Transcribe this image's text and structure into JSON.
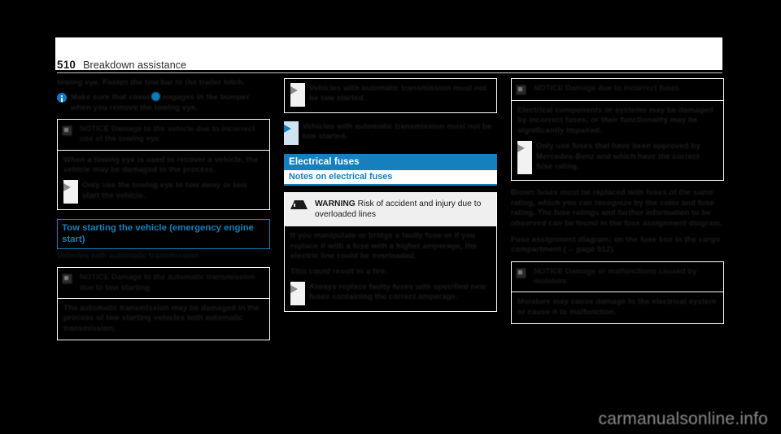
{
  "document": {
    "page_number": "510",
    "chapter": "Breakdown assistance",
    "watermark": "carmanualsonline.info"
  },
  "left_column": {
    "continued_paragraph": "towing eye. Fasten the tow bar to the trailer hitch.",
    "info_note_pre": "Make sure that cover",
    "info_note_post": "engages in the bumper when you remove the towing eye.",
    "notice_towing_eye": {
      "label": "NOTICE",
      "title": "Damage to the vehicle due to incorrect use of the towing eye",
      "body": "When a towing eye is used to recover a vehicle, the vehicle may be damaged in the process.",
      "bullet": "Only use the towing eye to tow away or tow start the vehicle."
    },
    "heading_tow_start": "Tow starting the vehicle (emergency engine start)",
    "subheading_automatic": "Vehicles with automatic transmission",
    "notice_tow_start": {
      "label": "NOTICE",
      "title": "Damage to the automatic transmission due to tow starting",
      "body": "The automatic transmission may be damaged in the process of tow starting vehicles with automatic transmission."
    }
  },
  "middle_column": {
    "notice_bullet": "Vehicles with automatic transmission must not be tow started.",
    "blue_bullet": "Vehicles with automatic transmission must not be tow started.",
    "heading_electrical_fuses": "Electrical fuses",
    "subheading_notes": "Notes on electrical fuses",
    "warning": {
      "label": "WARNING",
      "title": "Risk of accident and injury due to overloaded lines",
      "body_1": "If you manipulate or bridge a faulty fuse or if you replace it with a fuse with a higher amperage, the electric line could be overloaded.",
      "body_2": "This could result in a fire.",
      "bullet": "Always replace faulty fuses with specified new fuses containing the correct amperage."
    }
  },
  "right_column": {
    "notice_incorrect_fuses": {
      "label": "NOTICE",
      "title": "Damage due to incorrect fuses",
      "body": "Electrical components or systems may be damaged by incorrect fuses, or their functionality may be significantly impaired.",
      "bullet": "Only use fuses that have been approved by Mercedes-Benz and which have the correct fuse rating."
    },
    "paragraph_1": "Blown fuses must be replaced with fuses of the same rating, which you can recognize by the color and fuse rating. The fuse ratings and further information to be observed can be found in the fuse assignment diagram.",
    "paragraph_2": "Fuse assignment diagram: on the fuse box in the cargo compartment (→ page 512).",
    "notice_moisture": {
      "label": "NOTICE",
      "title": "Damage or malfunctions caused by moisture",
      "body": "Moisture may cause damage to the electrical system or cause it to malfunction."
    }
  },
  "colors": {
    "accent_teal": "#1580bb",
    "page_background": "#000000",
    "header_band": "#ffffff",
    "warning_head_background": "#efefef"
  }
}
